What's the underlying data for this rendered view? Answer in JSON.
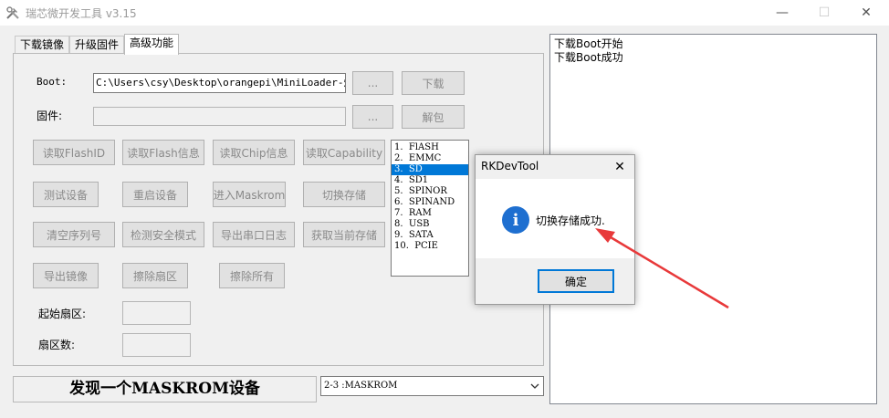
{
  "window": {
    "title": "瑞芯微开发工具 v3.15",
    "minimize_glyph": "—",
    "maximize_glyph": "☐",
    "close_glyph": "✕"
  },
  "tabs": [
    {
      "label": "下载镜像",
      "active": false
    },
    {
      "label": "升级固件",
      "active": false
    },
    {
      "label": "高级功能",
      "active": true
    }
  ],
  "advanced": {
    "boot_label": "Boot:",
    "boot_path": "C:\\Users\\csy\\Desktop\\orangepi\\MiniLoader-烧录",
    "boot_browse": "...",
    "boot_download": "下载",
    "firmware_label": "固件:",
    "firmware_path": "",
    "firmware_browse": "...",
    "firmware_unpack": "解包",
    "buttons": {
      "read_flash_id": "读取FlashID",
      "read_flash_info": "读取Flash信息",
      "read_chip_info": "读取Chip信息",
      "read_capability": "读取Capability",
      "test_device": "测试设备",
      "reset_device": "重启设备",
      "enter_maskrom": "进入Maskrom",
      "switch_storage": "切换存储",
      "clear_serial": "清空序列号",
      "detect_secure_mode": "检测安全模式",
      "export_serial_log": "导出串口日志",
      "get_current_storage": "获取当前存储",
      "export_image": "导出镜像",
      "erase_sector": "擦除扇区",
      "erase_all": "擦除所有"
    },
    "start_sector_label": "起始扇区:",
    "sector_count_label": "扇区数:",
    "start_sector_value": "",
    "sector_count_value": ""
  },
  "storage_list": {
    "items": [
      "1.  FlASH",
      "2.  EMMC",
      "3.  SD",
      "4.  SD1",
      "5.  SPINOR",
      "6.  SPINAND",
      "7.  RAM",
      "8.  USB",
      "9.  SATA",
      "10.  PCIE"
    ],
    "selected_index": 2
  },
  "status_bar": {
    "text": "发现一个MASKROM设备",
    "device_select": "2-3  :MASKROM"
  },
  "log": {
    "lines": [
      "下载Boot开始",
      "下载Boot成功"
    ]
  },
  "dialog": {
    "title": "RKDevTool",
    "message": "切换存储成功.",
    "ok_label": "确定",
    "icon": "info-icon",
    "icon_glyph": "i"
  },
  "colors": {
    "selection": "#0078d7",
    "info_icon": "#1e6fd0",
    "annotation_arrow": "#e8393a"
  }
}
